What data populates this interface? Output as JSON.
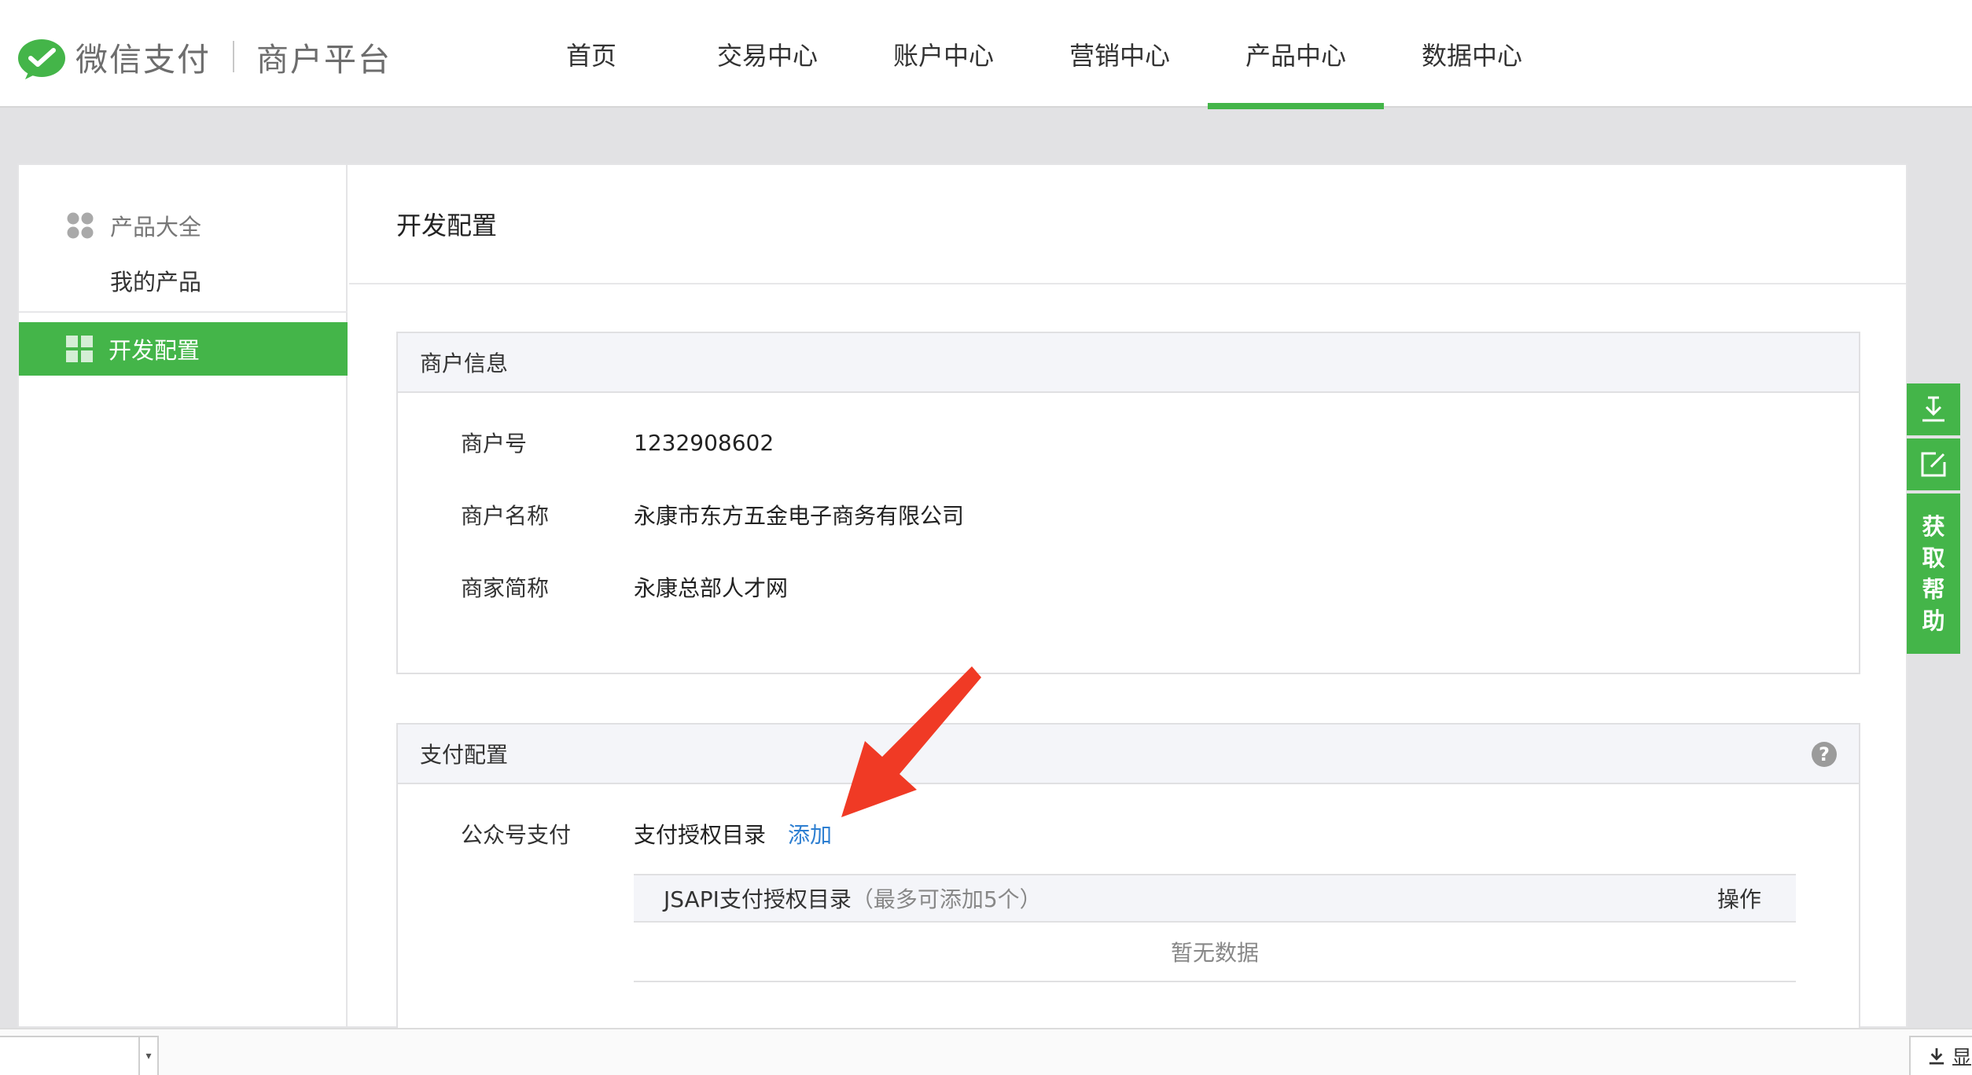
{
  "brand": {
    "name": "微信支付",
    "platform": "商户平台"
  },
  "nav": [
    {
      "label": "首页"
    },
    {
      "label": "交易中心"
    },
    {
      "label": "账户中心"
    },
    {
      "label": "营销中心"
    },
    {
      "label": "产品中心",
      "active": true
    },
    {
      "label": "数据中心"
    }
  ],
  "sidebar": {
    "group_label": "产品大全",
    "sub_item": "我的产品",
    "active_item": "开发配置"
  },
  "main": {
    "title": "开发配置",
    "merchant_panel": {
      "title": "商户信息",
      "rows": [
        {
          "key": "商户号",
          "value": "1232908602"
        },
        {
          "key": "商户名称",
          "value": "永康市东方五金电子商务有限公司"
        },
        {
          "key": "商家简称",
          "value": "永康总部人才网"
        }
      ]
    },
    "pay_panel": {
      "title": "支付配置",
      "help_glyph": "?",
      "row_key": "公众号支付",
      "row_value": "支付授权目录",
      "add_link": "添加",
      "table": {
        "header": "JSAPI支付授权目录",
        "header_tip": "（最多可添加5个）",
        "op_header": "操作",
        "empty_text": "暂无数据"
      }
    }
  },
  "float_tools": {
    "help_chars": [
      "获",
      "取",
      "帮",
      "助"
    ]
  },
  "bottom_bar": {
    "button_label": "显"
  },
  "colors": {
    "brand_green": "#44b549",
    "link_blue": "#2e7fd1",
    "annotation_red": "#f03a25"
  }
}
